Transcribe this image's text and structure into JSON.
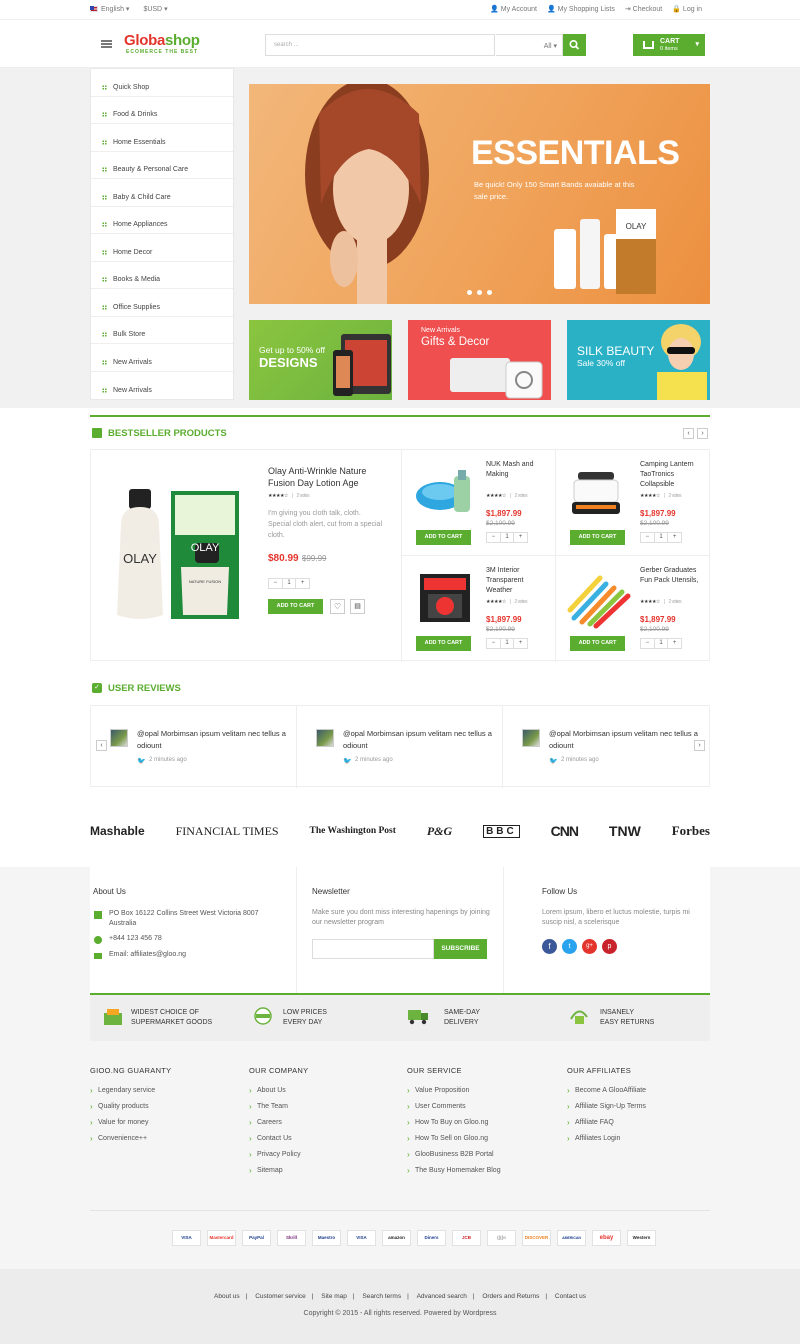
{
  "topbar": {
    "language": "English",
    "currency": "$USD",
    "links": [
      "My Account",
      "My Shopping Lists",
      "Checkout",
      "Log in"
    ]
  },
  "header": {
    "logo_part1": "Globa",
    "logo_part2": "shop",
    "tagline": "ECOMERCE THE BEST",
    "search_placeholder": "search ...",
    "category": "All",
    "cart_label": "CART",
    "cart_items": "0 items"
  },
  "sidebar": {
    "items": [
      "Quick Shop",
      "Food & Drinks",
      "Home Essentials",
      "Beauty & Personal Care",
      "Baby & Child Care",
      "Home Appliances",
      "Home Decor",
      "Books & Media",
      "Office Supplies",
      "Bulk Store",
      "New Arrivals",
      "New Arrivals"
    ]
  },
  "hero": {
    "title": "ESSENTIALS",
    "text": "Be quick! Only 150 Smart Bands avaiable at this sale price.",
    "product_brand": "OLAY"
  },
  "banners": [
    {
      "line1": "Get up to 50% off",
      "line2": "DESIGNS"
    },
    {
      "line1": "New Arrivals",
      "line2": "Gifts & Decor"
    },
    {
      "line1": "SILK BEAUTY",
      "line2": "Sale 30% off"
    }
  ],
  "bestseller": {
    "title": "BESTSELLER PRODUCTS",
    "featured": {
      "name": "Olay Anti-Wrinkle Nature Fusion Day Lotion Age",
      "votes": "2 votes",
      "desc": "I'm giving you cloth talk, cloth. Special cloth alert, cut from a special cloth.",
      "price": "$80.99",
      "old_price": "$99.99",
      "qty": "1",
      "add_label": "ADD TO CART",
      "brand": "OLAY",
      "product_text": "ANTI-WRINKLE",
      "product_sub": "NATURE FUSION",
      "product_note": "day lotion"
    },
    "items": [
      {
        "name": "NUK Mash and Making",
        "votes": "2 votes",
        "price": "$1,897.99",
        "old_price": "$2,100.99",
        "qty": "1",
        "add_label": "ADD TO CART"
      },
      {
        "name": "Camping Lantern TaoTronics Collapsible",
        "votes": "2 votes",
        "price": "$1,897.99",
        "old_price": "$2,100.99",
        "qty": "1",
        "add_label": "ADD TO CART"
      },
      {
        "name": "3M Interior Transparent Weather",
        "votes": "2 votes",
        "price": "$1,897.99",
        "old_price": "$2,100.99",
        "qty": "1",
        "add_label": "ADD TO CART"
      },
      {
        "name": "Gerber Graduates Fun Pack Utensils,",
        "votes": "2 votes",
        "price": "$1,897.99",
        "old_price": "$2,100.99",
        "qty": "1",
        "add_label": "ADD TO CART"
      }
    ]
  },
  "reviews": {
    "title": "USER REVIEWS",
    "items": [
      {
        "text": "@opal Morbimsan ipsum velitam nec tellus a odiount",
        "time": "2 minutes ago"
      },
      {
        "text": "@opal Morbimsan ipsum velitam nec tellus a odiount",
        "time": "2 minutes ago"
      },
      {
        "text": "@opal Morbimsan ipsum velitam nec tellus a odiount",
        "time": "2 minutes ago"
      }
    ]
  },
  "press": [
    "Mashable",
    "FINANCIAL TIMES",
    "The Washington Post",
    "P&G",
    "BBC",
    "CNN",
    "TNW",
    "Forbes"
  ],
  "footer": {
    "about": {
      "title": "About Us",
      "address": "PO Box 16122 Collins Street West Victoria 8007 Australia",
      "phone": "+844 123 456 78",
      "email": "Email: affiliates@gloo.ng"
    },
    "newsletter": {
      "title": "Newsletter",
      "text": "Make sure you dont miss interesting hapenings by joining our newsletter program",
      "button": "SUBSCRIBE"
    },
    "follow": {
      "title": "Follow Us",
      "text": "Lorem ipsum, libero et luctus molestie, turpis mi suscip nisl, a scelerisque"
    },
    "features": [
      {
        "line1": "WIDEST CHOICE OF",
        "line2": "SUPERMARKET GOODS"
      },
      {
        "line1": "LOW PRICES",
        "line2": "EVERY DAY"
      },
      {
        "line1": "SAME-DAY",
        "line2": "DELIVERY"
      },
      {
        "line1": "INSANELY",
        "line2": "EASY RETURNS"
      }
    ],
    "columns": [
      {
        "title": "GIOO.NG GUARANTY",
        "items": [
          "Legendary service",
          "Quality products",
          "Value for money",
          "Convenience++"
        ]
      },
      {
        "title": "OUR COMPANY",
        "items": [
          "About Us",
          "The Team",
          "Careers",
          "Contact Us",
          "Privacy Policy",
          "Sitemap"
        ]
      },
      {
        "title": "OUR SERVICE",
        "items": [
          "Value Proposition",
          "User Comments",
          "How To Buy on Gloo.ng",
          "How To Sell on Gloo.ng",
          "GlooBusiness B2B Portal",
          "The Busy Homemaker Blog"
        ]
      },
      {
        "title": "OUR AFFILIATES",
        "items": [
          "Become A GlooAffiliate",
          "Affiliate Sign-Up Terms",
          "Affiliate FAQ",
          "Affiliates Login"
        ]
      }
    ],
    "payments": [
      "VISA",
      "Mastercard",
      "PayPal",
      "Skrill",
      "Maestro",
      "VISA Electron",
      "amazon",
      "Diners",
      "JCB",
      "((((o",
      "DISCOVER",
      "AMERICAN EXPRESS",
      "ebay",
      "Western"
    ],
    "bottom_links": [
      "About us",
      "Customer service",
      "Site map",
      "Search terms",
      "Advanced search",
      "Orders and Returns",
      "Contact us"
    ],
    "copyright": "Copyright © 2015 - All rights reserved. Powered by Wordpress"
  },
  "colors": {
    "accent": "#5aad2f",
    "price": "#e4352d",
    "hero": "#f0a35a"
  },
  "icons": [
    "flag-icon",
    "user-icon",
    "list-icon",
    "checkout-icon",
    "lock-icon",
    "hamburger-icon",
    "search-icon",
    "cart-icon",
    "twitter-icon",
    "facebook-icon",
    "google-plus-icon",
    "pinterest-icon"
  ]
}
